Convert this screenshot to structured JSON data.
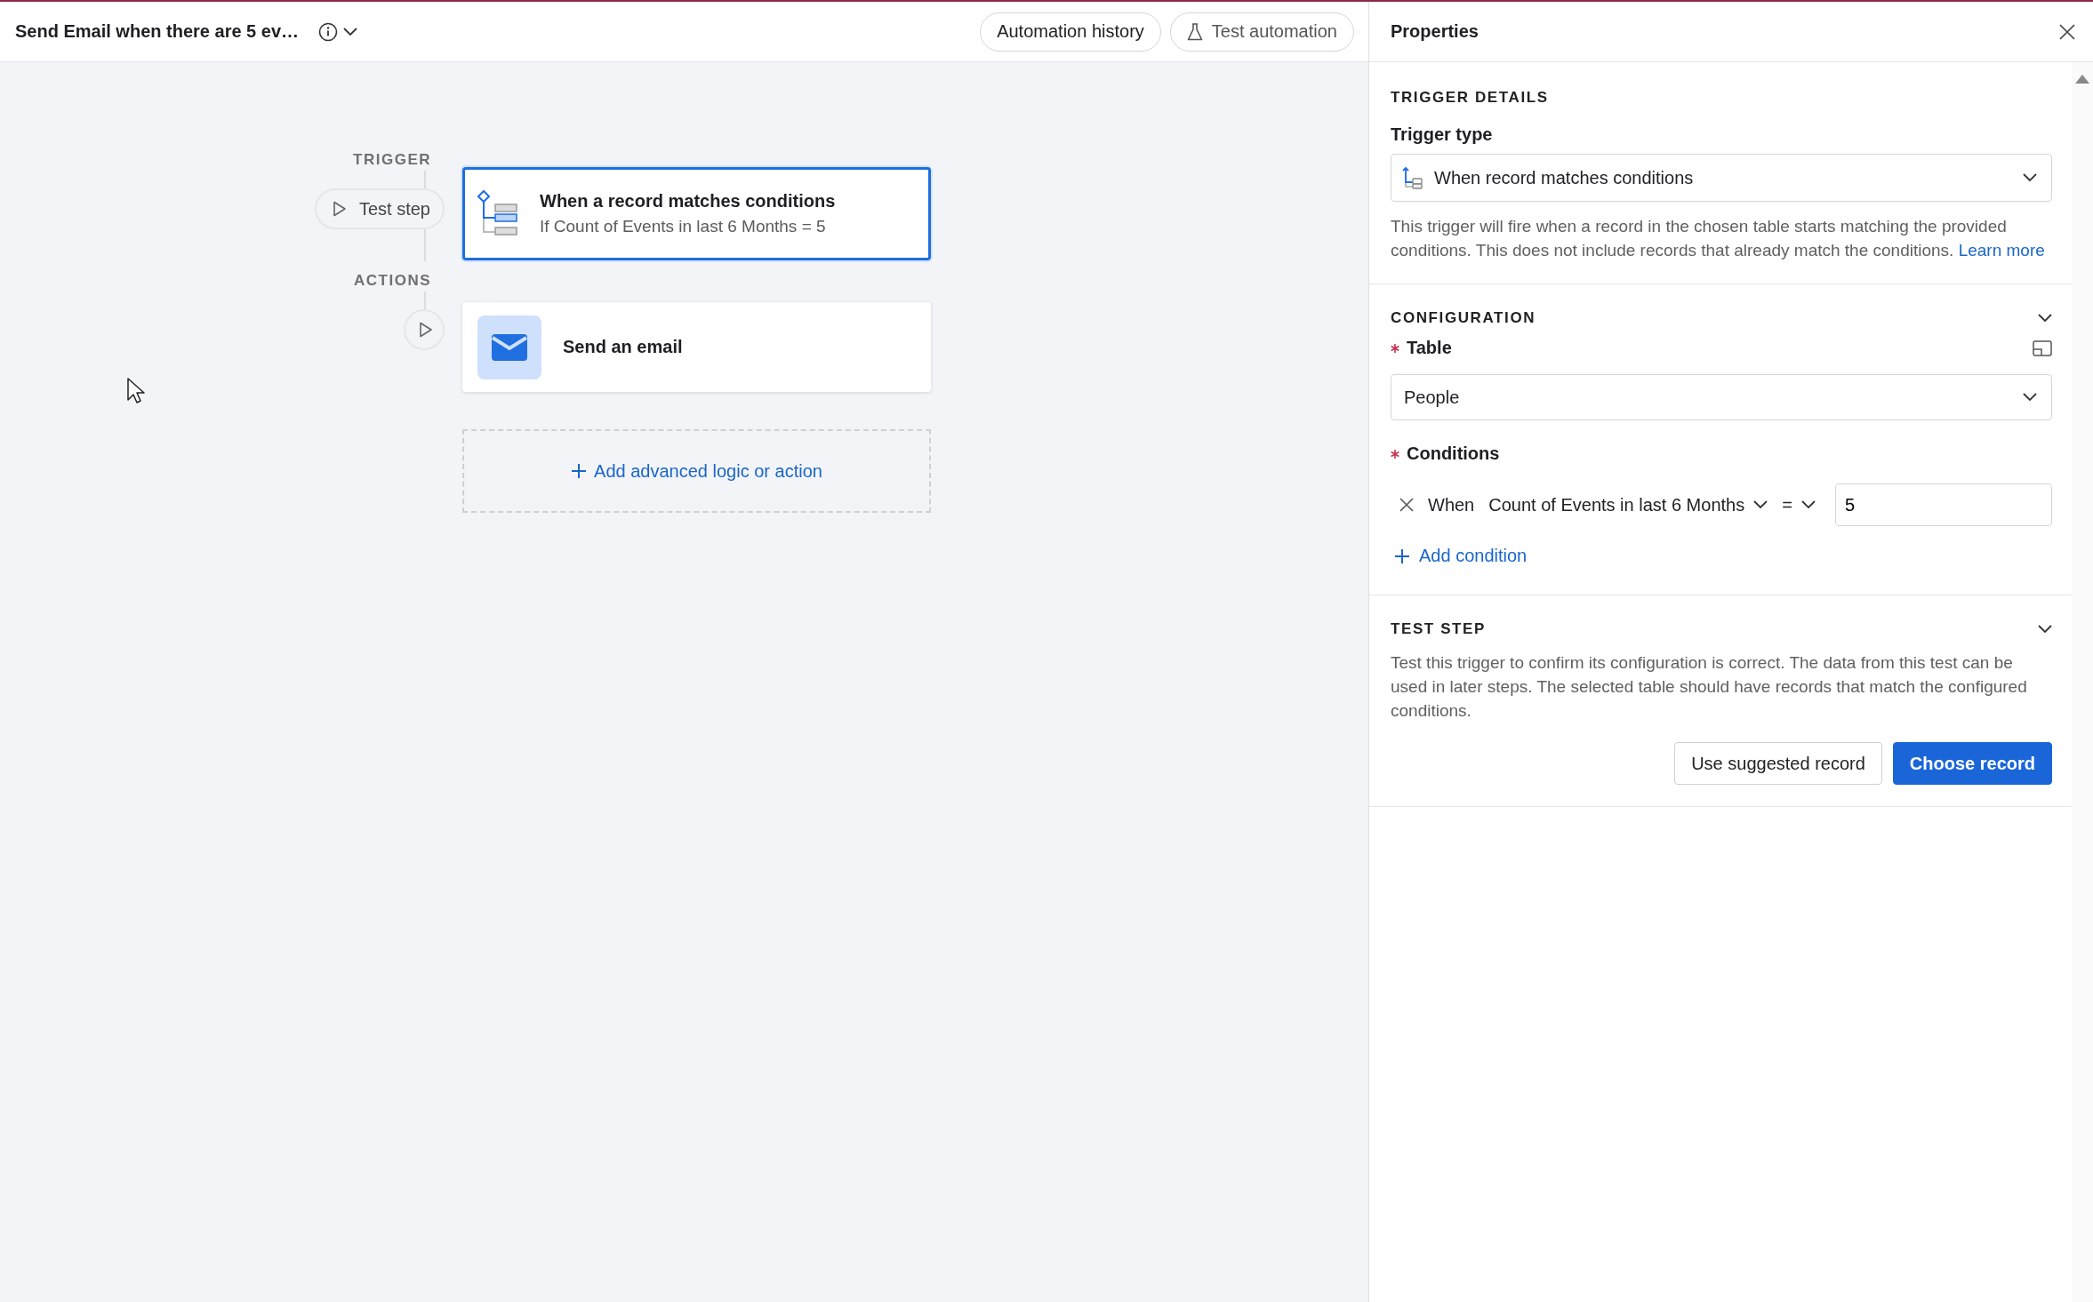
{
  "header": {
    "title": "Send Email when there are 5 ev…",
    "buttons": [
      {
        "label": "Automation history",
        "kind": "plain"
      },
      {
        "label": "Test automation",
        "kind": "flask"
      }
    ]
  },
  "canvas": {
    "trigger_label": "TRIGGER",
    "test_step_button": "Test step",
    "actions_label": "ACTIONS",
    "trigger_card": {
      "title": "When a record matches conditions",
      "subtitle": "If Count of Events in last 6 Months = 5",
      "selected": true
    },
    "action_cards": [
      {
        "title": "Send an email",
        "selected": false
      }
    ],
    "add_button": "Add advanced logic or action"
  },
  "properties": {
    "title": "Properties",
    "trigger_details": {
      "heading": "TRIGGER DETAILS",
      "trigger_type_label": "Trigger type",
      "trigger_type_value": "When record matches conditions",
      "description": "This trigger will fire when a record in the chosen table starts matching the provided conditions. This does not include records that already match the conditions.",
      "link": "Learn more"
    },
    "configuration": {
      "heading": "CONFIGURATION",
      "table": {
        "label": "Table",
        "required": true,
        "value": "People"
      },
      "conditions": {
        "label": "Conditions",
        "required": true,
        "rows": [
          {
            "prefix": "When",
            "field": "Count of Events in last 6 Months",
            "operator": "=",
            "value": "5"
          }
        ],
        "add_button": "Add condition"
      }
    },
    "test_step": {
      "heading": "TEST STEP",
      "description": "Test this trigger to confirm its configuration is correct. The data from this test can be used in later steps. The selected table should have records that match the configured conditions.",
      "buttons": [
        {
          "label": "Use suggested record",
          "kind": "secondary"
        },
        {
          "label": "Choose record",
          "kind": "primary"
        }
      ]
    }
  }
}
